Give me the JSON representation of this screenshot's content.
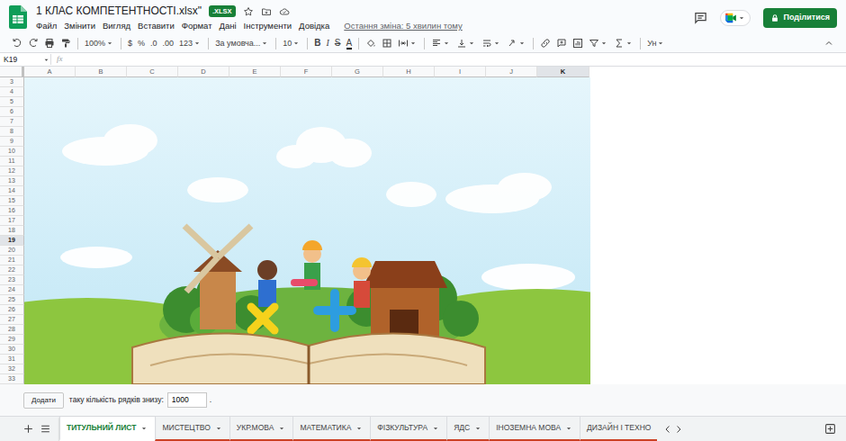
{
  "document": {
    "title": "1 КЛАС КОМПЕТЕНТНОСТІ.xlsx\"",
    "badge": ".XLSX",
    "last_edit": "Остання зміна: 5 хвилин тому"
  },
  "menu": [
    "Файл",
    "Змінити",
    "Вигляд",
    "Вставити",
    "Формат",
    "Дані",
    "Інструменти",
    "Довідка"
  ],
  "share_button": "Поділитися",
  "toolbar": {
    "zoom": "100%",
    "currency": "$",
    "percent": "%",
    "decrease_decimal": ".0",
    "increase_decimal": ".00",
    "number_format": "123",
    "font": "За умовча...",
    "font_size": "10",
    "bold": "B",
    "italic": "I",
    "strikethrough": "S",
    "text_color": "A",
    "input_tools": "Ун"
  },
  "formula_bar": {
    "cell": "K19",
    "fx": "fx"
  },
  "columns": [
    {
      "label": "A",
      "selected": false
    },
    {
      "label": "B",
      "selected": false
    },
    {
      "label": "C",
      "selected": false
    },
    {
      "label": "D",
      "selected": false
    },
    {
      "label": "E",
      "selected": false
    },
    {
      "label": "F",
      "selected": false
    },
    {
      "label": "G",
      "selected": false
    },
    {
      "label": "H",
      "selected": false
    },
    {
      "label": "I",
      "selected": false
    },
    {
      "label": "J",
      "selected": false
    },
    {
      "label": "K",
      "selected": true
    }
  ],
  "rows": [
    {
      "label": "3",
      "selected": false
    },
    {
      "label": "4",
      "selected": false
    },
    {
      "label": "5",
      "selected": false
    },
    {
      "label": "6",
      "selected": false
    },
    {
      "label": "7",
      "selected": false
    },
    {
      "label": "8",
      "selected": false
    },
    {
      "label": "9",
      "selected": false
    },
    {
      "label": "10",
      "selected": false
    },
    {
      "label": "11",
      "selected": false
    },
    {
      "label": "12",
      "selected": false
    },
    {
      "label": "13",
      "selected": false
    },
    {
      "label": "14",
      "selected": false
    },
    {
      "label": "15",
      "selected": false
    },
    {
      "label": "16",
      "selected": false
    },
    {
      "label": "17",
      "selected": false
    },
    {
      "label": "18",
      "selected": false
    },
    {
      "label": "19",
      "selected": true
    },
    {
      "label": "20",
      "selected": false
    },
    {
      "label": "21",
      "selected": false
    },
    {
      "label": "22",
      "selected": false
    },
    {
      "label": "23",
      "selected": false
    },
    {
      "label": "24",
      "selected": false
    },
    {
      "label": "25",
      "selected": false
    },
    {
      "label": "26",
      "selected": false
    },
    {
      "label": "27",
      "selected": false
    },
    {
      "label": "28",
      "selected": false
    },
    {
      "label": "29",
      "selected": false
    },
    {
      "label": "30",
      "selected": false
    },
    {
      "label": "31",
      "selected": false
    },
    {
      "label": "32",
      "selected": false
    },
    {
      "label": "33",
      "selected": false
    }
  ],
  "add_rows": {
    "button": "Додати",
    "label": "таку кількість рядків знизу:",
    "value": "1000",
    "suffix": "."
  },
  "sheets": [
    {
      "label": "ТИТУЛЬНИЙ ЛИСТ",
      "selected": true,
      "menu": true
    },
    {
      "label": "МИСТЕЦТВО",
      "selected": false,
      "menu": true
    },
    {
      "label": "УКР.МОВА",
      "selected": false,
      "menu": true
    },
    {
      "label": "МАТЕМАТИКА",
      "selected": false,
      "menu": true
    },
    {
      "label": "ФІЗКУЛЬТУРА",
      "selected": false,
      "menu": true
    },
    {
      "label": "ЯДС",
      "selected": false,
      "menu": true
    },
    {
      "label": "ІНОЗЕМНА МОВА",
      "selected": false,
      "menu": true
    },
    {
      "label": "ДИЗАЙН І ТЕХНО",
      "selected": false,
      "menu": false
    }
  ]
}
